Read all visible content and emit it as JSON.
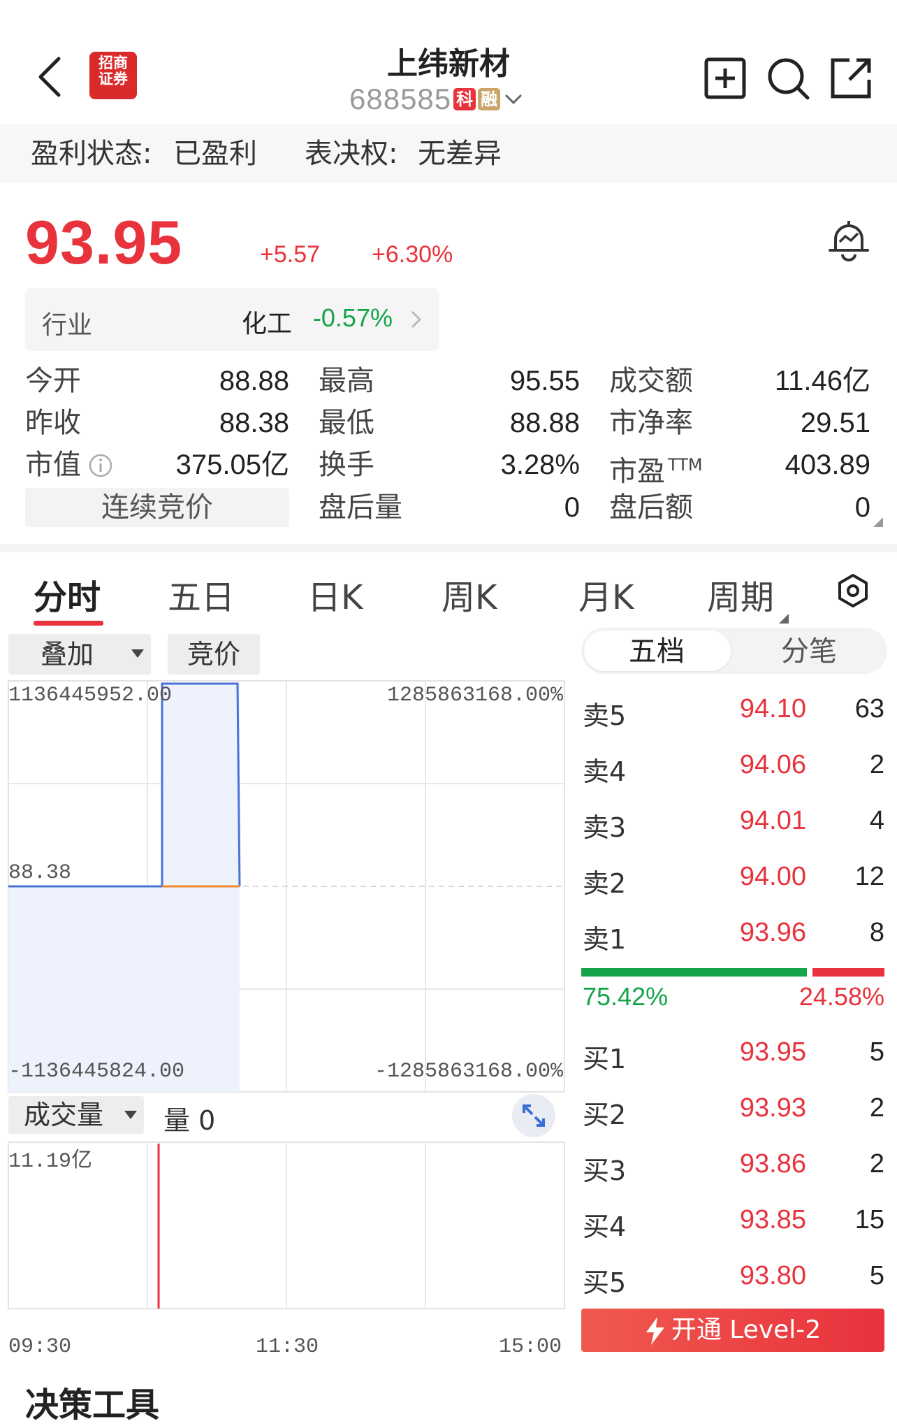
{
  "header": {
    "broker_logo_text": "招商证券",
    "stock_name": "上纬新材",
    "stock_code": "688585",
    "tag_star": "科",
    "tag_margin": "融"
  },
  "status": {
    "profit_label": "盈利状态:",
    "profit_value": "已盈利",
    "vote_label": "表决权:",
    "vote_value": "无差异"
  },
  "quote": {
    "price": "93.95",
    "change": "+5.57",
    "change_pct": "+6.30%"
  },
  "industry": {
    "label": "行业",
    "name": "化工",
    "change_pct": "-0.57%"
  },
  "stats": {
    "open_label": "今开",
    "open_value": "88.88",
    "high_label": "最高",
    "high_value": "95.55",
    "turnover_amt_label": "成交额",
    "turnover_amt_value": "11.46亿",
    "prev_close_label": "昨收",
    "prev_close_value": "88.38",
    "low_label": "最低",
    "low_value": "88.88",
    "pb_label": "市净率",
    "pb_value": "29.51",
    "mktcap_label": "市值",
    "mktcap_value": "375.05亿",
    "turnover_label": "换手",
    "turnover_value": "3.28%",
    "pe_label": "市盈",
    "pe_sup": "TTM",
    "pe_value": "403.89",
    "auction_label": "连续竞价",
    "after_vol_label": "盘后量",
    "after_vol_value": "0",
    "after_amt_label": "盘后额",
    "after_amt_value": "0"
  },
  "tabs": [
    "分时",
    "五日",
    "日K",
    "周K",
    "月K",
    "周期"
  ],
  "chart_controls": {
    "overlay_label": "叠加",
    "auction_label": "竞价",
    "volume_label": "成交量",
    "volume_value": "量 0"
  },
  "chart_axis": {
    "top_left": "1136445952.00",
    "top_right": "1285863168.00%",
    "mid_left": "88.38",
    "bottom_left": "-1136445824.00",
    "bottom_right": "-1285863168.00%",
    "vol_top": "11.19亿",
    "time_start": "09:30",
    "time_mid": "11:30",
    "time_end": "15:00"
  },
  "orderbook": {
    "tab_five": "五档",
    "tab_ticks": "分笔",
    "asks": [
      {
        "level": "卖5",
        "price": "94.10",
        "volume": "63"
      },
      {
        "level": "卖4",
        "price": "94.06",
        "volume": "2"
      },
      {
        "level": "卖3",
        "price": "94.01",
        "volume": "4"
      },
      {
        "level": "卖2",
        "price": "94.00",
        "volume": "12"
      },
      {
        "level": "卖1",
        "price": "93.96",
        "volume": "8"
      }
    ],
    "bids": [
      {
        "level": "买1",
        "price": "93.95",
        "volume": "5"
      },
      {
        "level": "买2",
        "price": "93.93",
        "volume": "2"
      },
      {
        "level": "买3",
        "price": "93.86",
        "volume": "2"
      },
      {
        "level": "买4",
        "price": "93.85",
        "volume": "15"
      },
      {
        "level": "买5",
        "price": "93.80",
        "volume": "5"
      }
    ],
    "buy_ratio": "75.42%",
    "sell_ratio": "24.58%",
    "buy_fraction": 0.7542,
    "level2_button": "开通 Level-2"
  },
  "bottom_section_title": "决策工具",
  "colors": {
    "up": "#e8323c",
    "down": "#16a34a",
    "price_line": "#4a72d6",
    "avg_line": "#f08a30"
  }
}
